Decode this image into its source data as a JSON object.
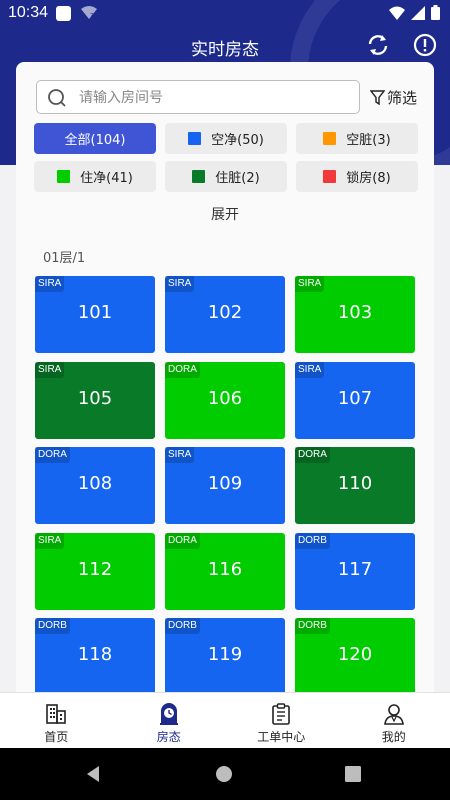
{
  "status_bar": {
    "time": "10:34"
  },
  "header": {
    "title": "实时房态"
  },
  "search": {
    "placeholder": "请输入房间号",
    "value": ""
  },
  "filter": {
    "label": "筛选"
  },
  "chips": [
    {
      "label": "全部(104)",
      "color": "",
      "active": true
    },
    {
      "label": "空净(50)",
      "color": "#1565f0",
      "active": false
    },
    {
      "label": "空脏(3)",
      "color": "#ff9800",
      "active": false
    },
    {
      "label": "住净(41)",
      "color": "#00cc00",
      "active": false
    },
    {
      "label": "住脏(2)",
      "color": "#087a28",
      "active": false
    },
    {
      "label": "锁房(8)",
      "color": "#f03a3a",
      "active": false
    }
  ],
  "expand_label": "展开",
  "floor": {
    "label": "01层/1"
  },
  "rooms": [
    {
      "number": "101",
      "tag": "SIRA",
      "color": "#1565f0"
    },
    {
      "number": "102",
      "tag": "SIRA",
      "color": "#1565f0"
    },
    {
      "number": "103",
      "tag": "SIRA",
      "color": "#00cc00"
    },
    {
      "number": "105",
      "tag": "SIRA",
      "color": "#087a28"
    },
    {
      "number": "106",
      "tag": "DORA",
      "color": "#00cc00"
    },
    {
      "number": "107",
      "tag": "SIRA",
      "color": "#1565f0"
    },
    {
      "number": "108",
      "tag": "DORA",
      "color": "#1565f0"
    },
    {
      "number": "109",
      "tag": "SIRA",
      "color": "#1565f0"
    },
    {
      "number": "110",
      "tag": "DORA",
      "color": "#087a28"
    },
    {
      "number": "112",
      "tag": "SIRA",
      "color": "#00cc00"
    },
    {
      "number": "116",
      "tag": "DORA",
      "color": "#00cc00"
    },
    {
      "number": "117",
      "tag": "DORB",
      "color": "#1565f0"
    },
    {
      "number": "118",
      "tag": "DORB",
      "color": "#1565f0"
    },
    {
      "number": "119",
      "tag": "DORB",
      "color": "#1565f0"
    },
    {
      "number": "120",
      "tag": "DORB",
      "color": "#00cc00"
    }
  ],
  "bottom_nav": [
    {
      "label": "首页",
      "icon": "building-icon",
      "active": false
    },
    {
      "label": "房态",
      "icon": "room-status-icon",
      "active": true
    },
    {
      "label": "工单中心",
      "icon": "clipboard-icon",
      "active": false
    },
    {
      "label": "我的",
      "icon": "user-icon",
      "active": false
    }
  ],
  "colors": {
    "header": "#1d2a8c",
    "active_chip": "#3f55d6"
  }
}
